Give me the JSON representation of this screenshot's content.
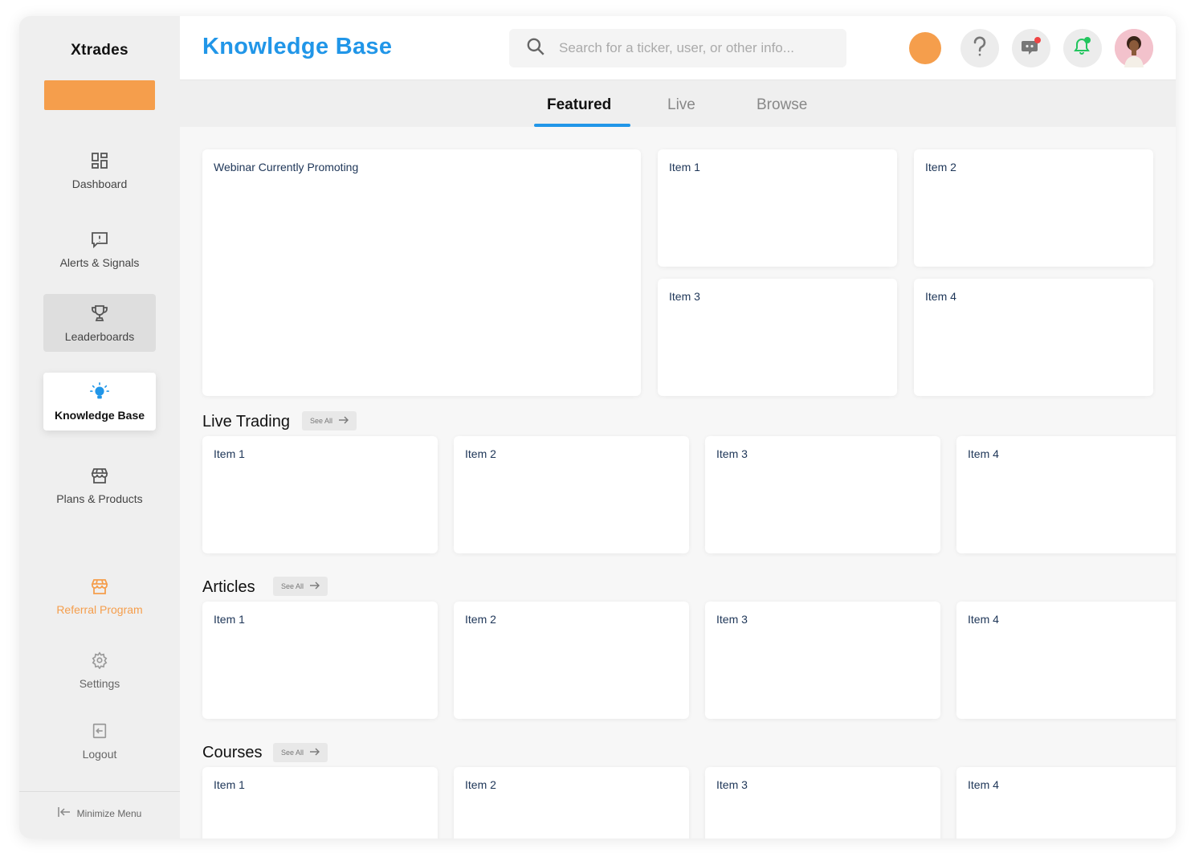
{
  "sidebar": {
    "brand": "Xtrades",
    "items": [
      {
        "label": "Dashboard",
        "icon": "dashboard-icon"
      },
      {
        "label": "Alerts & Signals",
        "icon": "alert-icon"
      },
      {
        "label": "Leaderboards",
        "icon": "trophy-icon"
      },
      {
        "label": "Knowledge Base",
        "icon": "lightbulb-icon"
      },
      {
        "label": "Plans & Products",
        "icon": "store-icon"
      },
      {
        "label": "Referral Program",
        "icon": "store-icon"
      },
      {
        "label": "Settings",
        "icon": "gear-icon"
      },
      {
        "label": "Logout",
        "icon": "logout-icon"
      }
    ],
    "minimize_label": "Minimize Menu"
  },
  "header": {
    "title": "Knowledge Base",
    "search_placeholder": "Search for a ticker, user, or other info..."
  },
  "tabs": [
    {
      "label": "Featured",
      "active": true
    },
    {
      "label": "Live",
      "active": false
    },
    {
      "label": "Browse",
      "active": false
    }
  ],
  "featured": {
    "main": "Webinar Currently Promoting",
    "items": [
      "Item 1",
      "Item 2",
      "Item 3",
      "Item 4"
    ]
  },
  "sections": [
    {
      "title": "Live Trading",
      "see_all": "See All",
      "items": [
        "Item 1",
        "Item 2",
        "Item 3",
        "Item 4"
      ]
    },
    {
      "title": "Articles",
      "see_all": "See All",
      "items": [
        "Item 1",
        "Item 2",
        "Item 3",
        "Item 4"
      ]
    },
    {
      "title": "Courses",
      "see_all": "See All",
      "items": [
        "Item 1",
        "Item 2",
        "Item 3",
        "Item 4"
      ]
    }
  ],
  "colors": {
    "accent_blue": "#2196e8",
    "accent_orange": "#f59e4c",
    "notification_red": "#ef4444",
    "notification_green": "#22c55e"
  }
}
